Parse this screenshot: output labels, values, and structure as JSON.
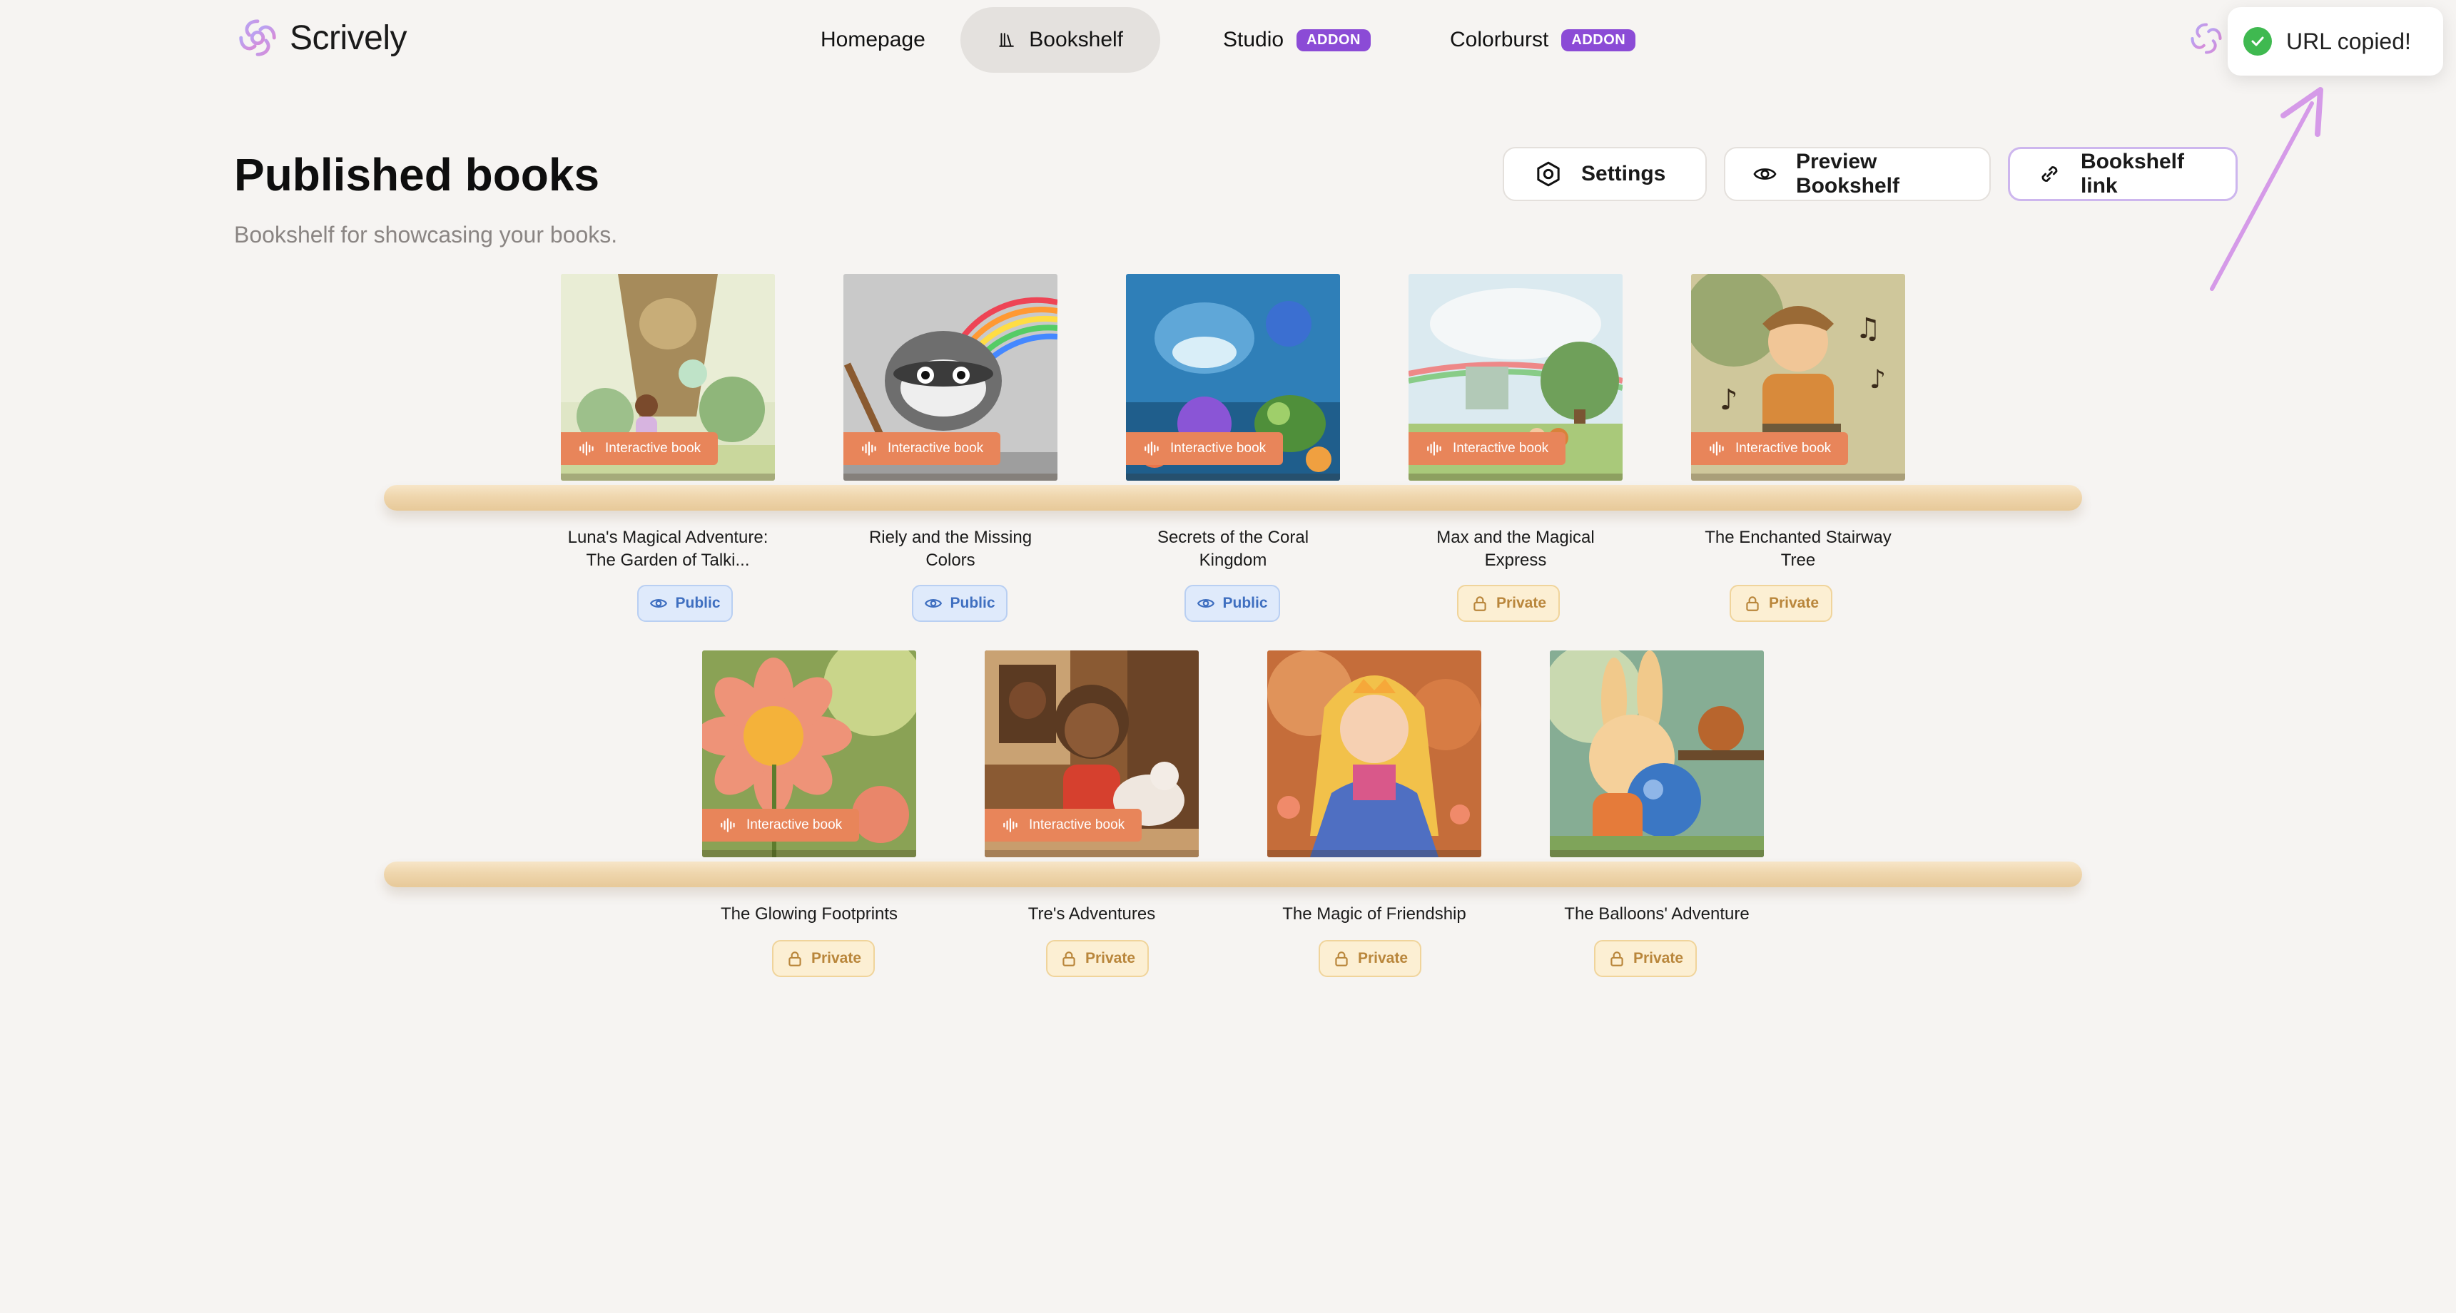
{
  "app": {
    "name": "Scrively"
  },
  "nav": {
    "items": [
      {
        "label": "Homepage",
        "icon": "home-icon",
        "active": false
      },
      {
        "label": "Bookshelf",
        "icon": "bookshelf-icon",
        "active": true
      },
      {
        "label": "Studio",
        "icon": "audio-wave-icon",
        "badge": "ADDON",
        "active": false
      },
      {
        "label": "Colorburst",
        "icon": "palette-icon",
        "badge": "ADDON",
        "active": false
      }
    ]
  },
  "toast": {
    "message": "URL copied!",
    "icon": "check-circle-icon",
    "color": "#3fb950"
  },
  "page": {
    "title": "Published books",
    "subtitle": "Bookshelf for showcasing your books."
  },
  "actions": {
    "settings": "Settings",
    "preview": "Preview Bookshelf",
    "link": "Bookshelf link"
  },
  "colors": {
    "accent": "#8b4bd6",
    "interactive_tag": "#e8855a",
    "public": "#3f6fc0",
    "private": "#b9863b",
    "background": "#f6f4f2"
  },
  "books": [
    {
      "title_line1": "Luna's Magical Adventure:",
      "title_line2": "The Garden of Talki...",
      "tag": "Interactive book",
      "status": "Public"
    },
    {
      "title_line1": "Riely and the Missing",
      "title_line2": "Colors",
      "tag": "Interactive book",
      "status": "Public"
    },
    {
      "title_line1": "Secrets of the Coral",
      "title_line2": "Kingdom",
      "tag": "Interactive book",
      "status": "Public"
    },
    {
      "title_line1": "Max and the Magical",
      "title_line2": "Express",
      "tag": "Interactive book",
      "status": "Private"
    },
    {
      "title_line1": "The Enchanted Stairway",
      "title_line2": "Tree",
      "tag": "Interactive book",
      "status": "Private"
    },
    {
      "title_line1": "The Glowing Footprints",
      "title_line2": "",
      "tag": "Interactive book",
      "status": "Private"
    },
    {
      "title_line1": "Tre's Adventures",
      "title_line2": "",
      "tag": "Interactive book",
      "status": "Private"
    },
    {
      "title_line1": "The Magic of Friendship",
      "title_line2": "",
      "tag": "",
      "status": "Private"
    },
    {
      "title_line1": "The Balloons' Adventure",
      "title_line2": "",
      "tag": "",
      "status": "Private"
    }
  ]
}
